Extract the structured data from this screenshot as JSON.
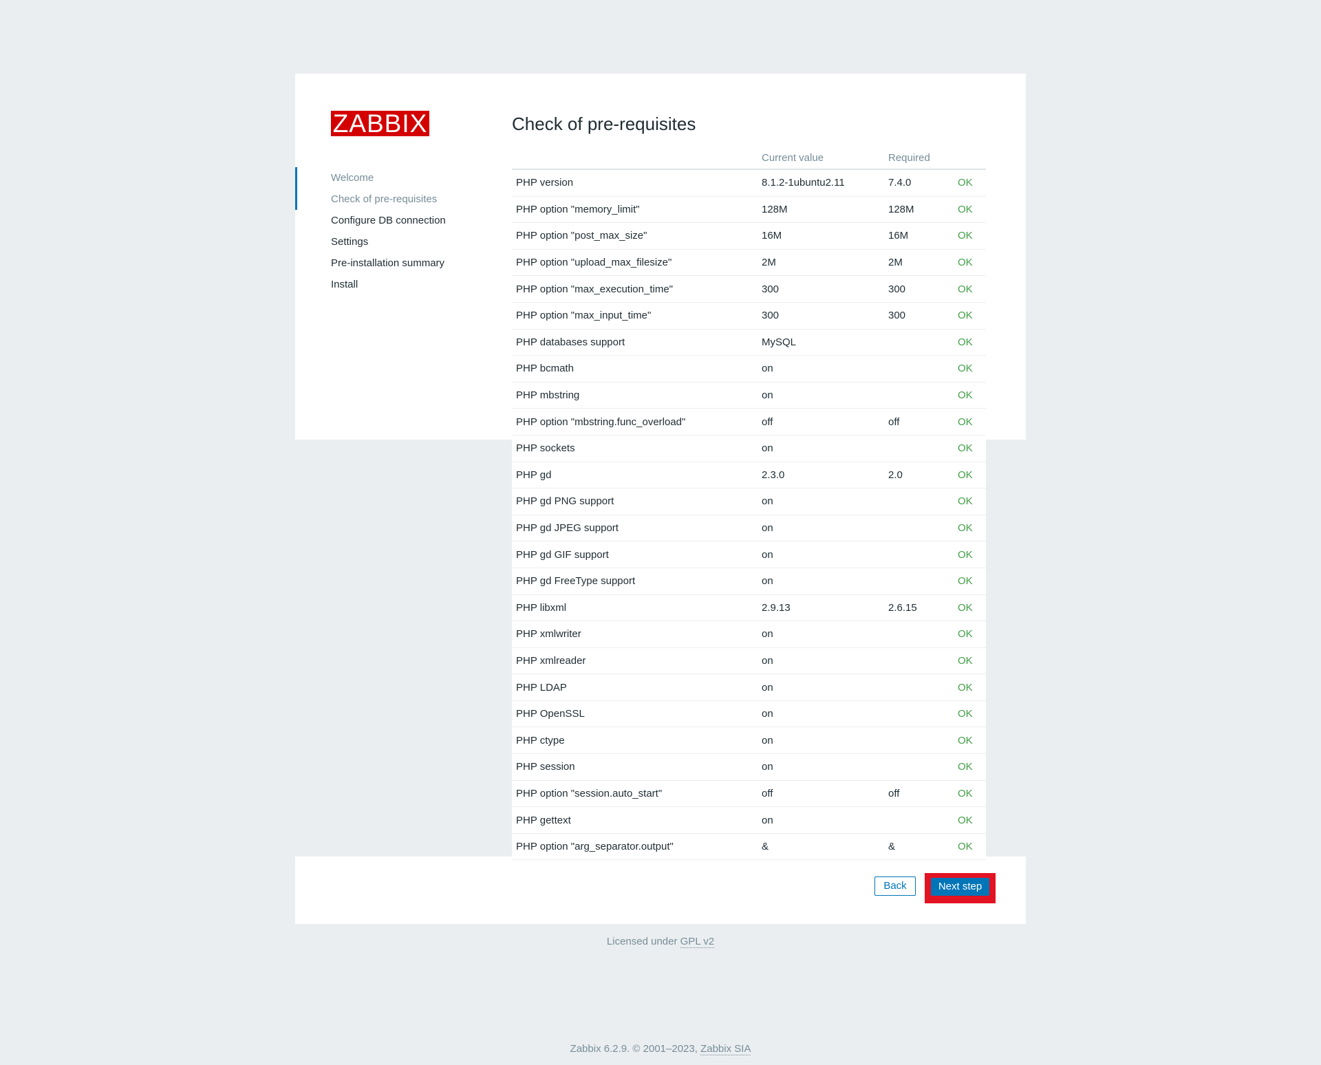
{
  "logo": {
    "text": "ZABBIX"
  },
  "sidebar": {
    "items": [
      {
        "label": "Welcome"
      },
      {
        "label": "Check of pre-requisites"
      },
      {
        "label": "Configure DB connection"
      },
      {
        "label": "Settings"
      },
      {
        "label": "Pre-installation summary"
      },
      {
        "label": "Install"
      }
    ]
  },
  "main": {
    "title": "Check of pre-requisites",
    "table": {
      "headers": [
        "",
        "Current value",
        "Required",
        ""
      ],
      "rows": [
        {
          "name": "PHP version",
          "current": "8.1.2-1ubuntu2.11",
          "required": "7.4.0",
          "status": "OK"
        },
        {
          "name": "PHP option \"memory_limit\"",
          "current": "128M",
          "required": "128M",
          "status": "OK"
        },
        {
          "name": "PHP option \"post_max_size\"",
          "current": "16M",
          "required": "16M",
          "status": "OK"
        },
        {
          "name": "PHP option \"upload_max_filesize\"",
          "current": "2M",
          "required": "2M",
          "status": "OK"
        },
        {
          "name": "PHP option \"max_execution_time\"",
          "current": "300",
          "required": "300",
          "status": "OK"
        },
        {
          "name": "PHP option \"max_input_time\"",
          "current": "300",
          "required": "300",
          "status": "OK"
        },
        {
          "name": "PHP databases support",
          "current": "MySQL",
          "required": "",
          "status": "OK"
        },
        {
          "name": "PHP bcmath",
          "current": "on",
          "required": "",
          "status": "OK"
        },
        {
          "name": "PHP mbstring",
          "current": "on",
          "required": "",
          "status": "OK"
        },
        {
          "name": "PHP option \"mbstring.func_overload\"",
          "current": "off",
          "required": "off",
          "status": "OK"
        },
        {
          "name": "PHP sockets",
          "current": "on",
          "required": "",
          "status": "OK"
        },
        {
          "name": "PHP gd",
          "current": "2.3.0",
          "required": "2.0",
          "status": "OK"
        },
        {
          "name": "PHP gd PNG support",
          "current": "on",
          "required": "",
          "status": "OK"
        },
        {
          "name": "PHP gd JPEG support",
          "current": "on",
          "required": "",
          "status": "OK"
        },
        {
          "name": "PHP gd GIF support",
          "current": "on",
          "required": "",
          "status": "OK"
        },
        {
          "name": "PHP gd FreeType support",
          "current": "on",
          "required": "",
          "status": "OK"
        },
        {
          "name": "PHP libxml",
          "current": "2.9.13",
          "required": "2.6.15",
          "status": "OK"
        },
        {
          "name": "PHP xmlwriter",
          "current": "on",
          "required": "",
          "status": "OK"
        },
        {
          "name": "PHP xmlreader",
          "current": "on",
          "required": "",
          "status": "OK"
        },
        {
          "name": "PHP LDAP",
          "current": "on",
          "required": "",
          "status": "OK"
        },
        {
          "name": "PHP OpenSSL",
          "current": "on",
          "required": "",
          "status": "OK"
        },
        {
          "name": "PHP ctype",
          "current": "on",
          "required": "",
          "status": "OK"
        },
        {
          "name": "PHP session",
          "current": "on",
          "required": "",
          "status": "OK"
        },
        {
          "name": "PHP option \"session.auto_start\"",
          "current": "off",
          "required": "off",
          "status": "OK"
        },
        {
          "name": "PHP gettext",
          "current": "on",
          "required": "",
          "status": "OK"
        },
        {
          "name": "PHP option \"arg_separator.output\"",
          "current": "&",
          "required": "&",
          "status": "OK"
        }
      ]
    }
  },
  "buttons": {
    "back": "Back",
    "next": "Next step"
  },
  "footer": {
    "license_prefix": "Licensed under ",
    "license_link": "GPL v2",
    "copyright_prefix": "Zabbix 6.2.9. © 2001–2023, ",
    "copyright_link": "Zabbix SIA"
  },
  "colors": {
    "accent": "#0275b8",
    "brand": "#d40000",
    "ok": "#429e47",
    "highlight": "#e21323"
  }
}
